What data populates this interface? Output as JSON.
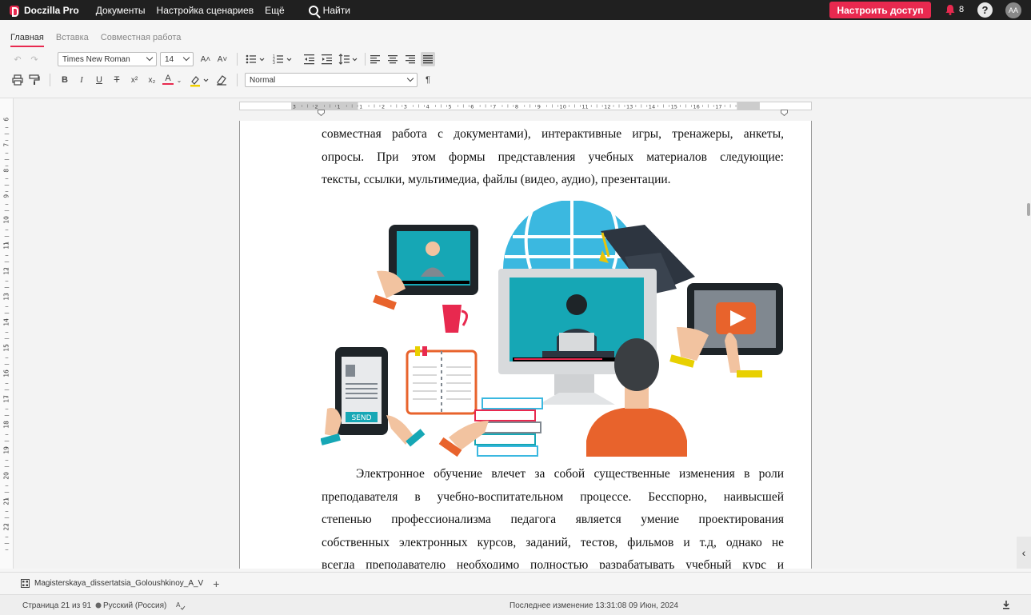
{
  "app": {
    "name": "Doczilla Pro",
    "menu": [
      "Документы",
      "Настройка сценариев",
      "Ещё"
    ],
    "search_label": "Найти",
    "access_button": "Настроить доступ",
    "notifications_count": "8",
    "help_label": "?",
    "avatar_initials": "AA",
    "accent_color": "#e8294f"
  },
  "ribbon": {
    "tabs": [
      "Главная",
      "Вставка",
      "Совместная работа"
    ],
    "active_tab": "Главная",
    "font_family": "Times New Roman",
    "font_size": "14",
    "style": "Normal",
    "bold": "B",
    "italic": "I",
    "underline": "U",
    "strike": "T",
    "superscript": "x²",
    "subscript": "x₂",
    "font_color": "A",
    "pilcrow": "¶",
    "grow": "A˄",
    "shrink": "A˅"
  },
  "rulers": {
    "horizontal": [
      "3",
      "2",
      "1",
      "1",
      "2",
      "3",
      "4",
      "5",
      "6",
      "7",
      "8",
      "9",
      "10",
      "11",
      "12",
      "13",
      "14",
      "15",
      "16",
      "17"
    ],
    "vertical": [
      "6",
      "7",
      "8",
      "9",
      "10",
      "11",
      "12",
      "13",
      "14",
      "15",
      "16",
      "17",
      "18",
      "19",
      "20",
      "21",
      "22"
    ]
  },
  "document": {
    "para1": [
      "совместная работа с документами), интерактивные игры, тренажеры, анкеты,",
      "опросы. При этом формы представления учебных материалов следующие:",
      "тексты, ссылки, мультимедиа, файлы (видео, аудио), презентации."
    ],
    "para2": [
      "Электронное обучение влечет за собой существенные изменения в роли",
      "преподавателя в учебно-воспитательном процессе. Бесспорно, наивысшей",
      "степенью профессионализма педагога является умение проектирования",
      "собственных электронных курсов, заданий, тестов, фильмов и т.д, однако не",
      "всегда преподавателю необходимо полностью разрабатывать учебный курс и"
    ],
    "illustration_send_text": "SEND"
  },
  "file_tab": {
    "name": "Magisterskaya_dissertatsia_Goloushkinoy_A_V",
    "add": "+"
  },
  "status": {
    "page": "Страница 21 из 91",
    "language": "Русский (Россия)",
    "last_modified": "Последнее изменение 13:31:08 09 Июн, 2024"
  }
}
